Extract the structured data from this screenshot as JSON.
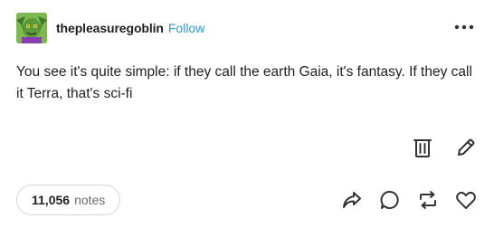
{
  "post": {
    "author": {
      "username": "thepleasuregoblin",
      "follow_label": "Follow",
      "avatar_icon": "goblin-avatar"
    },
    "menu_icon": "more-horizontal-icon",
    "body_text": "You see it's quite simple: if they call the earth Gaia, it's fantasy. If they call it Terra, that's sci-fi",
    "edit_tools": [
      {
        "icon": "trash-icon"
      },
      {
        "icon": "pencil-icon"
      }
    ],
    "footer": {
      "notes_count": "11,056",
      "notes_label": "notes",
      "actions": [
        {
          "icon": "share-icon"
        },
        {
          "icon": "reply-icon"
        },
        {
          "icon": "reblog-icon"
        },
        {
          "icon": "like-icon"
        }
      ]
    }
  },
  "colors": {
    "follow_link": "#2a9bd4",
    "text": "#1f1f1f",
    "muted": "#6b6b6b",
    "border": "#d6d6d6",
    "icon": "#333333"
  }
}
